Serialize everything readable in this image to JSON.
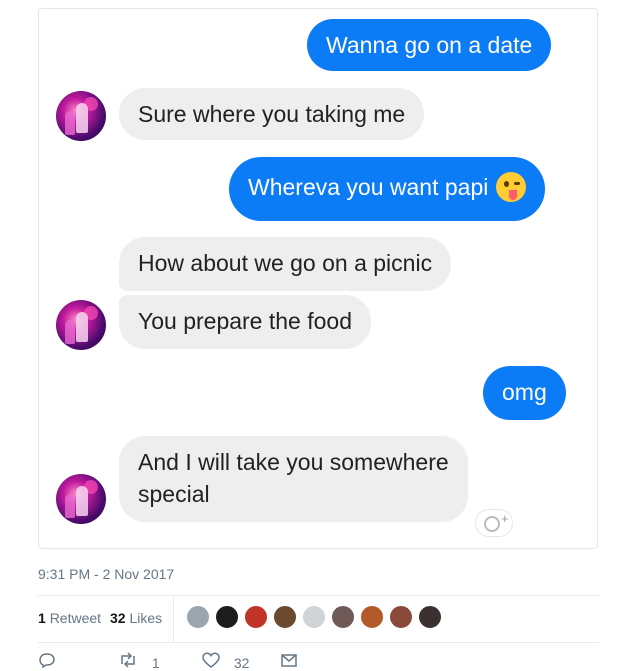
{
  "conversation": {
    "m1": "Wanna go on a date",
    "m2": "Sure where you taking me",
    "m3": "Whereva you want papi",
    "m4": "How about we go on a picnic",
    "m5": "You prepare the food",
    "m6": "omg",
    "m7_line1": "And I will take you somewhere",
    "m7_line2": "special",
    "m3_emoji": "tongue-out-emoji-icon",
    "react_plus": "+"
  },
  "tweet": {
    "timestamp": "9:31 PM - 2 Nov 2017",
    "retweets_count": "1",
    "retweets_label": "Retweet",
    "likes_count": "32",
    "likes_label": "Likes"
  },
  "actions": {
    "reply_icon": "reply-icon",
    "retweet_icon": "retweet-icon",
    "retweet_count": "1",
    "like_icon": "heart-icon",
    "like_count": "32",
    "dm_icon": "message-icon"
  },
  "colors": {
    "outgoing_bubble": "#0b7bf6",
    "incoming_bubble": "#eeeeef",
    "muted_text": "#657786"
  }
}
